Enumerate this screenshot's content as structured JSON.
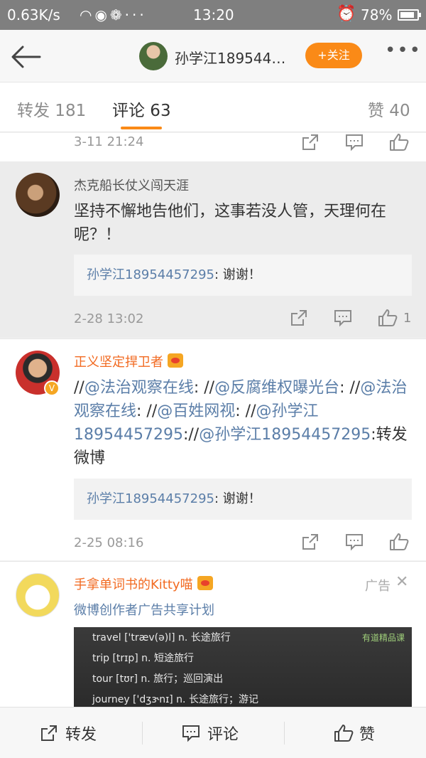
{
  "status_bar": {
    "speed": "0.63K/s",
    "icons": [
      "wifi-icon",
      "weibo-icon",
      "wechat-icon",
      "more-dots-icon"
    ],
    "time": "13:20",
    "battery": "78%"
  },
  "nav": {
    "title": "孙学江189544…",
    "follow_label": "+关注"
  },
  "tabs": [
    {
      "label": "转发 181"
    },
    {
      "label": "评论 63",
      "active": true
    },
    {
      "label": "赞 40"
    }
  ],
  "comments": [
    {
      "timestamp": "3-11 21:24"
    },
    {
      "username": "杰克船长仗义闯天涯",
      "text": "坚持不懈地告他们，这事若没人管，天理何在呢？！",
      "reply_name": "孙学江18954457295",
      "reply_text": ": 谢谢！",
      "timestamp": "2-28 13:02",
      "like_count": "1"
    },
    {
      "username": "正义坚定捍卫者",
      "text_parts": [
        "//",
        "@法治观察在线",
        ": //",
        "@反腐维权曝光台",
        ": //",
        "@法治观察在线",
        ": //",
        "@百姓网视",
        ": //",
        "@孙学江18954457295",
        "://",
        "@孙学江18954457295",
        ":转发微博"
      ],
      "reply_name": "孙学江18954457295",
      "reply_text": ": 谢谢！",
      "timestamp": "2-25 08:16"
    },
    {
      "username": "手拿单词书的Kitty喵",
      "subtitle": "微博创作者广告共享计划",
      "ad_label": "广告",
      "ad_image_lines": [
        "travel ['træv(ə)l] n. 长途旅行",
        "trip [trɪp] n. 短途旅行",
        "tour [tʊr] n. 旅行；巡回演出",
        "journey ['dʒɝnɪ] n. 长途旅行；游记"
      ],
      "ad_image_brand": "有道精品课"
    }
  ],
  "bottom_bar": {
    "repost_label": "转发",
    "comment_label": "评论",
    "like_label": "赞"
  },
  "colors": {
    "accent": "#fa8a17",
    "link": "#5b7ea8",
    "vip_name": "#f26a21"
  }
}
